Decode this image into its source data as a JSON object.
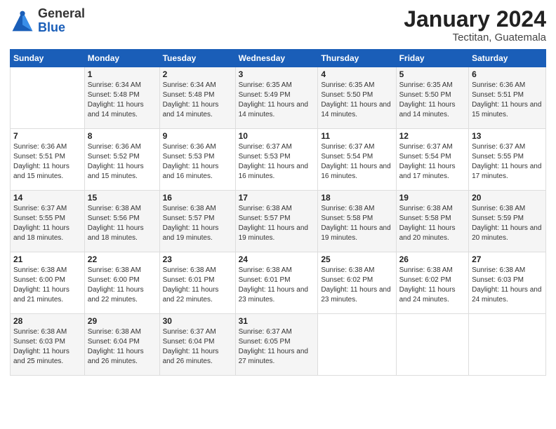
{
  "header": {
    "logo_general": "General",
    "logo_blue": "Blue",
    "title": "January 2024",
    "location": "Tectitan, Guatemala"
  },
  "days_of_week": [
    "Sunday",
    "Monday",
    "Tuesday",
    "Wednesday",
    "Thursday",
    "Friday",
    "Saturday"
  ],
  "weeks": [
    [
      {
        "day": "",
        "sunrise": "",
        "sunset": "",
        "daylight": ""
      },
      {
        "day": "1",
        "sunrise": "Sunrise: 6:34 AM",
        "sunset": "Sunset: 5:48 PM",
        "daylight": "Daylight: 11 hours and 14 minutes."
      },
      {
        "day": "2",
        "sunrise": "Sunrise: 6:34 AM",
        "sunset": "Sunset: 5:48 PM",
        "daylight": "Daylight: 11 hours and 14 minutes."
      },
      {
        "day": "3",
        "sunrise": "Sunrise: 6:35 AM",
        "sunset": "Sunset: 5:49 PM",
        "daylight": "Daylight: 11 hours and 14 minutes."
      },
      {
        "day": "4",
        "sunrise": "Sunrise: 6:35 AM",
        "sunset": "Sunset: 5:50 PM",
        "daylight": "Daylight: 11 hours and 14 minutes."
      },
      {
        "day": "5",
        "sunrise": "Sunrise: 6:35 AM",
        "sunset": "Sunset: 5:50 PM",
        "daylight": "Daylight: 11 hours and 14 minutes."
      },
      {
        "day": "6",
        "sunrise": "Sunrise: 6:36 AM",
        "sunset": "Sunset: 5:51 PM",
        "daylight": "Daylight: 11 hours and 15 minutes."
      }
    ],
    [
      {
        "day": "7",
        "sunrise": "Sunrise: 6:36 AM",
        "sunset": "Sunset: 5:51 PM",
        "daylight": "Daylight: 11 hours and 15 minutes."
      },
      {
        "day": "8",
        "sunrise": "Sunrise: 6:36 AM",
        "sunset": "Sunset: 5:52 PM",
        "daylight": "Daylight: 11 hours and 15 minutes."
      },
      {
        "day": "9",
        "sunrise": "Sunrise: 6:36 AM",
        "sunset": "Sunset: 5:53 PM",
        "daylight": "Daylight: 11 hours and 16 minutes."
      },
      {
        "day": "10",
        "sunrise": "Sunrise: 6:37 AM",
        "sunset": "Sunset: 5:53 PM",
        "daylight": "Daylight: 11 hours and 16 minutes."
      },
      {
        "day": "11",
        "sunrise": "Sunrise: 6:37 AM",
        "sunset": "Sunset: 5:54 PM",
        "daylight": "Daylight: 11 hours and 16 minutes."
      },
      {
        "day": "12",
        "sunrise": "Sunrise: 6:37 AM",
        "sunset": "Sunset: 5:54 PM",
        "daylight": "Daylight: 11 hours and 17 minutes."
      },
      {
        "day": "13",
        "sunrise": "Sunrise: 6:37 AM",
        "sunset": "Sunset: 5:55 PM",
        "daylight": "Daylight: 11 hours and 17 minutes."
      }
    ],
    [
      {
        "day": "14",
        "sunrise": "Sunrise: 6:37 AM",
        "sunset": "Sunset: 5:55 PM",
        "daylight": "Daylight: 11 hours and 18 minutes."
      },
      {
        "day": "15",
        "sunrise": "Sunrise: 6:38 AM",
        "sunset": "Sunset: 5:56 PM",
        "daylight": "Daylight: 11 hours and 18 minutes."
      },
      {
        "day": "16",
        "sunrise": "Sunrise: 6:38 AM",
        "sunset": "Sunset: 5:57 PM",
        "daylight": "Daylight: 11 hours and 19 minutes."
      },
      {
        "day": "17",
        "sunrise": "Sunrise: 6:38 AM",
        "sunset": "Sunset: 5:57 PM",
        "daylight": "Daylight: 11 hours and 19 minutes."
      },
      {
        "day": "18",
        "sunrise": "Sunrise: 6:38 AM",
        "sunset": "Sunset: 5:58 PM",
        "daylight": "Daylight: 11 hours and 19 minutes."
      },
      {
        "day": "19",
        "sunrise": "Sunrise: 6:38 AM",
        "sunset": "Sunset: 5:58 PM",
        "daylight": "Daylight: 11 hours and 20 minutes."
      },
      {
        "day": "20",
        "sunrise": "Sunrise: 6:38 AM",
        "sunset": "Sunset: 5:59 PM",
        "daylight": "Daylight: 11 hours and 20 minutes."
      }
    ],
    [
      {
        "day": "21",
        "sunrise": "Sunrise: 6:38 AM",
        "sunset": "Sunset: 6:00 PM",
        "daylight": "Daylight: 11 hours and 21 minutes."
      },
      {
        "day": "22",
        "sunrise": "Sunrise: 6:38 AM",
        "sunset": "Sunset: 6:00 PM",
        "daylight": "Daylight: 11 hours and 22 minutes."
      },
      {
        "day": "23",
        "sunrise": "Sunrise: 6:38 AM",
        "sunset": "Sunset: 6:01 PM",
        "daylight": "Daylight: 11 hours and 22 minutes."
      },
      {
        "day": "24",
        "sunrise": "Sunrise: 6:38 AM",
        "sunset": "Sunset: 6:01 PM",
        "daylight": "Daylight: 11 hours and 23 minutes."
      },
      {
        "day": "25",
        "sunrise": "Sunrise: 6:38 AM",
        "sunset": "Sunset: 6:02 PM",
        "daylight": "Daylight: 11 hours and 23 minutes."
      },
      {
        "day": "26",
        "sunrise": "Sunrise: 6:38 AM",
        "sunset": "Sunset: 6:02 PM",
        "daylight": "Daylight: 11 hours and 24 minutes."
      },
      {
        "day": "27",
        "sunrise": "Sunrise: 6:38 AM",
        "sunset": "Sunset: 6:03 PM",
        "daylight": "Daylight: 11 hours and 24 minutes."
      }
    ],
    [
      {
        "day": "28",
        "sunrise": "Sunrise: 6:38 AM",
        "sunset": "Sunset: 6:03 PM",
        "daylight": "Daylight: 11 hours and 25 minutes."
      },
      {
        "day": "29",
        "sunrise": "Sunrise: 6:38 AM",
        "sunset": "Sunset: 6:04 PM",
        "daylight": "Daylight: 11 hours and 26 minutes."
      },
      {
        "day": "30",
        "sunrise": "Sunrise: 6:37 AM",
        "sunset": "Sunset: 6:04 PM",
        "daylight": "Daylight: 11 hours and 26 minutes."
      },
      {
        "day": "31",
        "sunrise": "Sunrise: 6:37 AM",
        "sunset": "Sunset: 6:05 PM",
        "daylight": "Daylight: 11 hours and 27 minutes."
      },
      {
        "day": "",
        "sunrise": "",
        "sunset": "",
        "daylight": ""
      },
      {
        "day": "",
        "sunrise": "",
        "sunset": "",
        "daylight": ""
      },
      {
        "day": "",
        "sunrise": "",
        "sunset": "",
        "daylight": ""
      }
    ]
  ]
}
